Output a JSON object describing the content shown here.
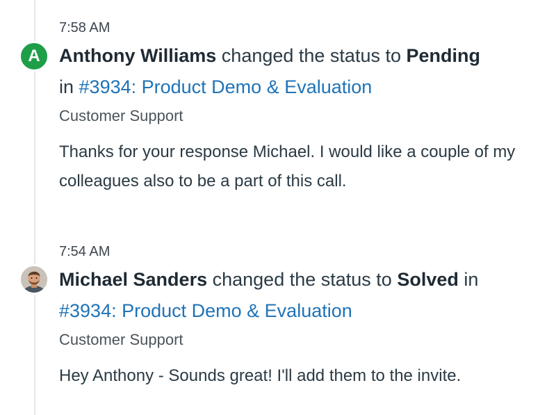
{
  "events": [
    {
      "time": "7:58 AM",
      "avatar_letter": "A",
      "author": "Anthony Williams",
      "action": "changed the status to",
      "status": "Pending",
      "preposition": "in",
      "ticket_link": "#3934: Product Demo & Evaluation",
      "group": "Customer Support",
      "message": "Thanks for your response Michael. I would like a couple of my colleagues also to be a part of this call."
    },
    {
      "time": "7:54 AM",
      "author": "Michael Sanders",
      "action": "changed the status to",
      "status": "Solved",
      "preposition": "in",
      "ticket_link": "#3934: Product Demo & Evaluation",
      "group": "Customer Support",
      "message": "Hey Anthony - Sounds great! I'll add them to the invite."
    }
  ],
  "colors": {
    "avatar_green": "#1f9e48",
    "link_blue": "#1f73b7",
    "timeline": "#e3e6e8"
  }
}
